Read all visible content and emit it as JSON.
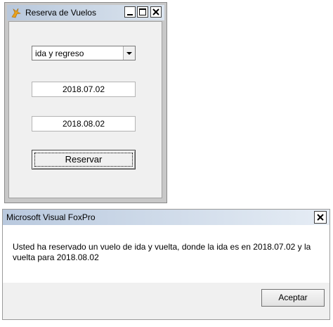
{
  "form": {
    "title": "Reserva de Vuelos",
    "trip_type": {
      "selected": "ida y regreso"
    },
    "departure_date": "2018.07.02",
    "return_date": "2018.08.02",
    "reserve_button": "Reservar"
  },
  "message_box": {
    "title": "Microsoft Visual FoxPro",
    "message": "Usted ha reservado un vuelo de ida y vuelta, donde la ida es en 2018.07.02 y la vuelta para 2018.08.02",
    "ok_button": "Aceptar"
  },
  "icons": {
    "app": "foxpro-fox-icon",
    "minimize": "minimize-icon",
    "maximize": "maximize-icon",
    "close": "close-icon",
    "dropdown": "chevron-down-icon"
  },
  "colors": {
    "titlebar": "#b8c8dc",
    "window_frame": "#c8c8c8",
    "client": "#f0f0f0",
    "icon_accent": "#e8a21c"
  }
}
